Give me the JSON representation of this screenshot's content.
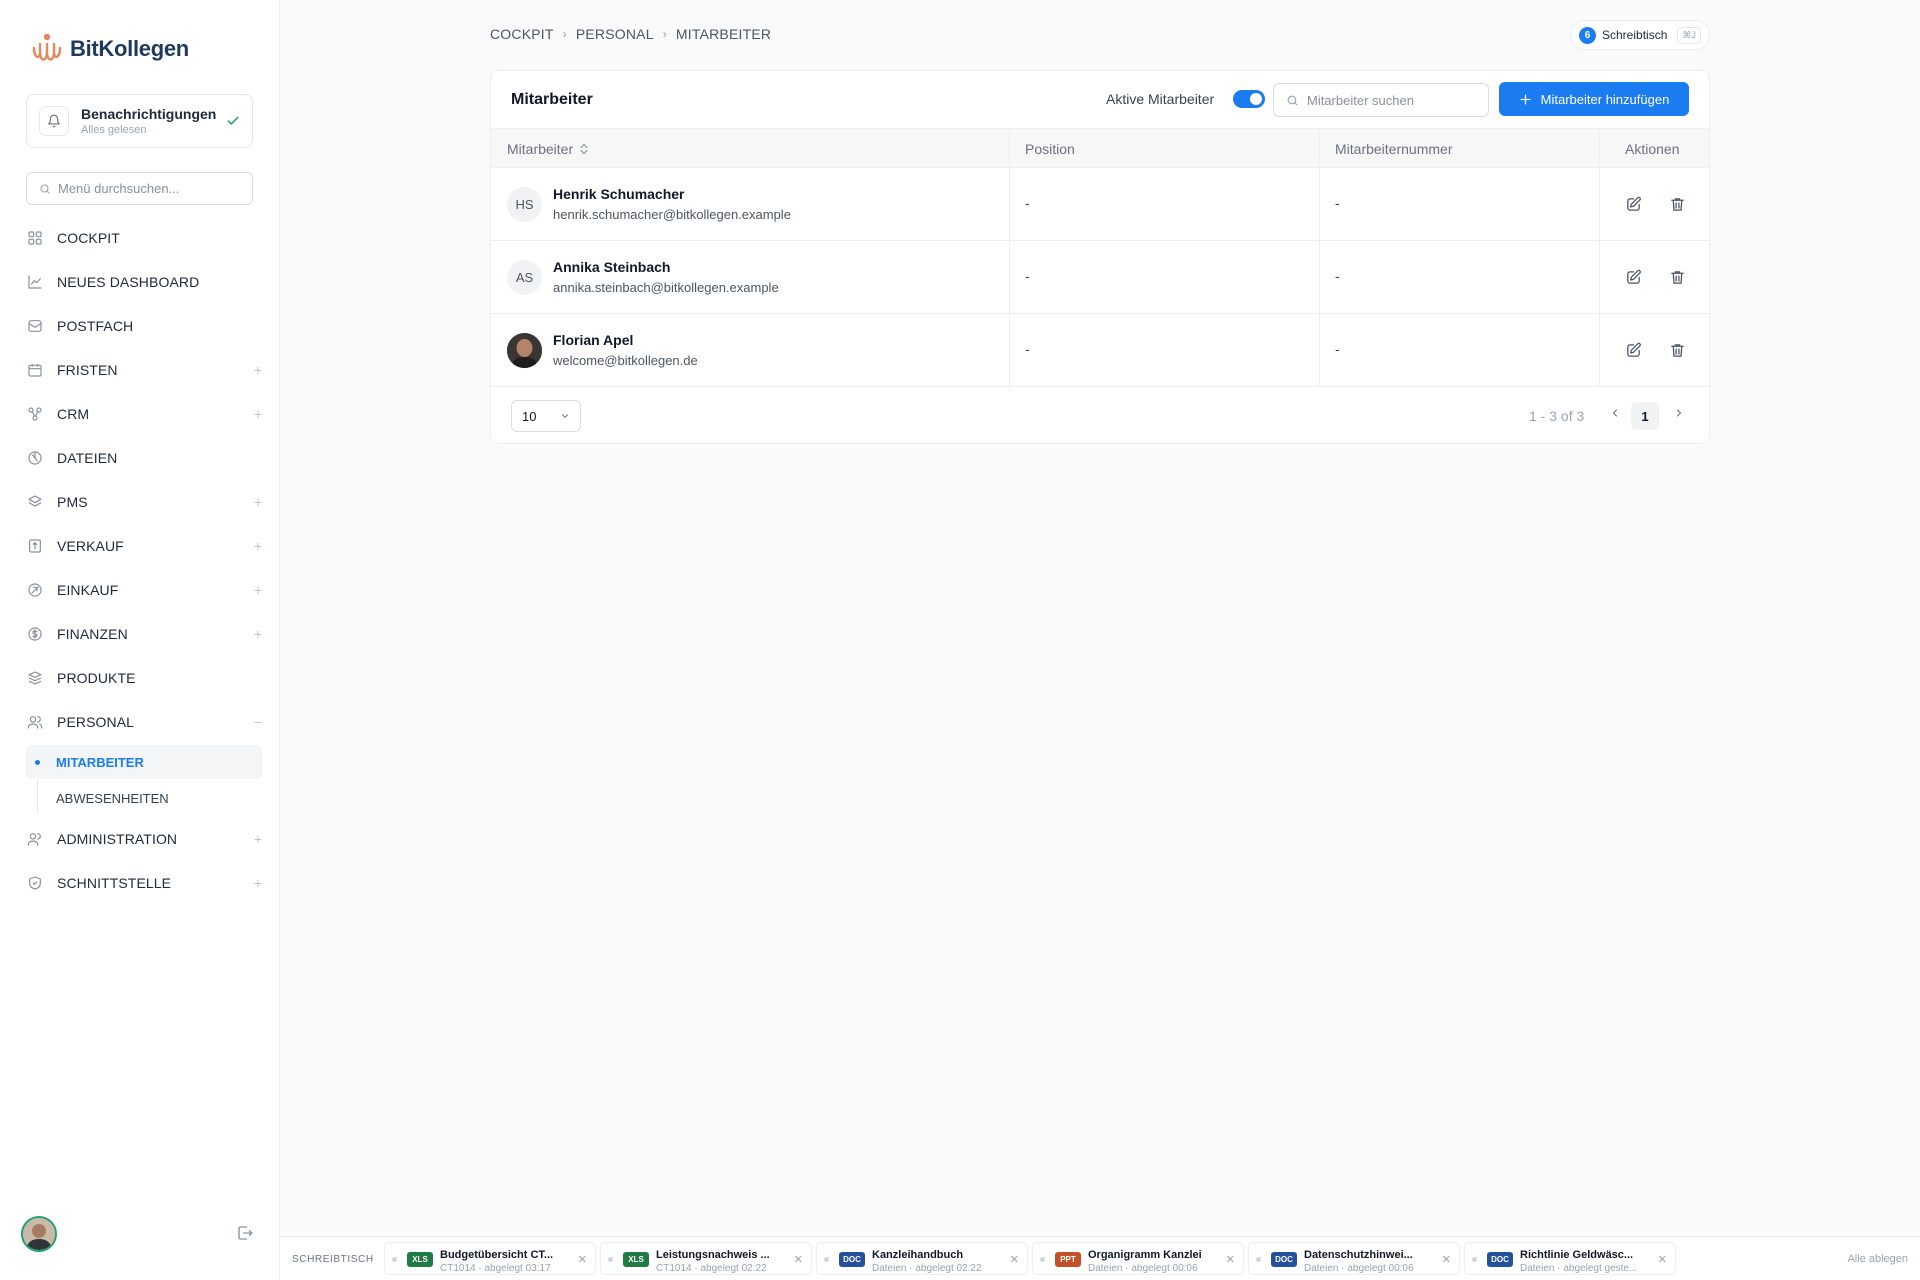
{
  "brand": {
    "name": "BitKollegen"
  },
  "notifications": {
    "title": "Benachrichtigungen",
    "subtitle": "Alles gelesen"
  },
  "menu_search": {
    "placeholder": "Menü durchsuchen..."
  },
  "nav": {
    "cockpit": "COCKPIT",
    "dashboard": "NEUES DASHBOARD",
    "postfach": "POSTFACH",
    "fristen": "FRISTEN",
    "crm": "CRM",
    "dateien": "DATEIEN",
    "pms": "PMS",
    "verkauf": "VERKAUF",
    "einkauf": "EINKAUF",
    "finanzen": "FINANZEN",
    "produkte": "PRODUKTE",
    "personal": "PERSONAL",
    "mitarbeiter": "MITARBEITER",
    "abwesenheiten": "ABWESENHEITEN",
    "administration": "ADMINISTRATION",
    "schnittstelle": "SCHNITTSTELLE"
  },
  "breadcrumb": [
    "COCKPIT",
    "PERSONAL",
    "MITARBEITER"
  ],
  "desk": {
    "count": "6",
    "label": "Schreibtisch",
    "shortcut": "⌘J"
  },
  "card": {
    "title": "Mitarbeiter",
    "toggle_label": "Aktive Mitarbeiter",
    "toggle_on": true,
    "search_placeholder": "Mitarbeiter suchen",
    "add_button": "Mitarbeiter hinzufügen"
  },
  "table": {
    "columns": [
      "Mitarbeiter",
      "Position",
      "Mitarbeiternummer",
      "Aktionen"
    ],
    "rows": [
      {
        "initials": "HS",
        "name": "Henrik Schumacher",
        "email": "henrik.schumacher@bitkollegen.example",
        "position": "-",
        "number": "-"
      },
      {
        "initials": "AS",
        "name": "Annika Steinbach",
        "email": "annika.steinbach@bitkollegen.example",
        "position": "-",
        "number": "-"
      },
      {
        "initials": "",
        "name": "Florian Apel",
        "email": "welcome@bitkollegen.de",
        "position": "-",
        "number": "-"
      }
    ]
  },
  "pagination": {
    "page_size": "10",
    "range": "1 - 3 of 3",
    "current_page": "1"
  },
  "dock": {
    "label": "SCHREIBTISCH",
    "clear": "Alle ablegen",
    "items": [
      {
        "type": "XLS",
        "color": "#1f7a44",
        "title": "Budgetübersicht CT...",
        "sub": "CT1014 · abgelegt 03:17"
      },
      {
        "type": "XLS",
        "color": "#1f7a44",
        "title": "Leistungsnachweis ...",
        "sub": "CT1014 · abgelegt 02:22"
      },
      {
        "type": "DOC",
        "color": "#24519b",
        "title": "Kanzleihandbuch",
        "sub": "Dateien · abgelegt 02:22"
      },
      {
        "type": "PPT",
        "color": "#c4502a",
        "title": "Organigramm Kanzlei",
        "sub": "Dateien · abgelegt 00:06"
      },
      {
        "type": "DOC",
        "color": "#24519b",
        "title": "Datenschutzhinwei...",
        "sub": "Dateien · abgelegt 00:06"
      },
      {
        "type": "DOC",
        "color": "#24519b",
        "title": "Richtlinie Geldwäsc...",
        "sub": "Dateien · abgelegt geste..."
      }
    ]
  }
}
